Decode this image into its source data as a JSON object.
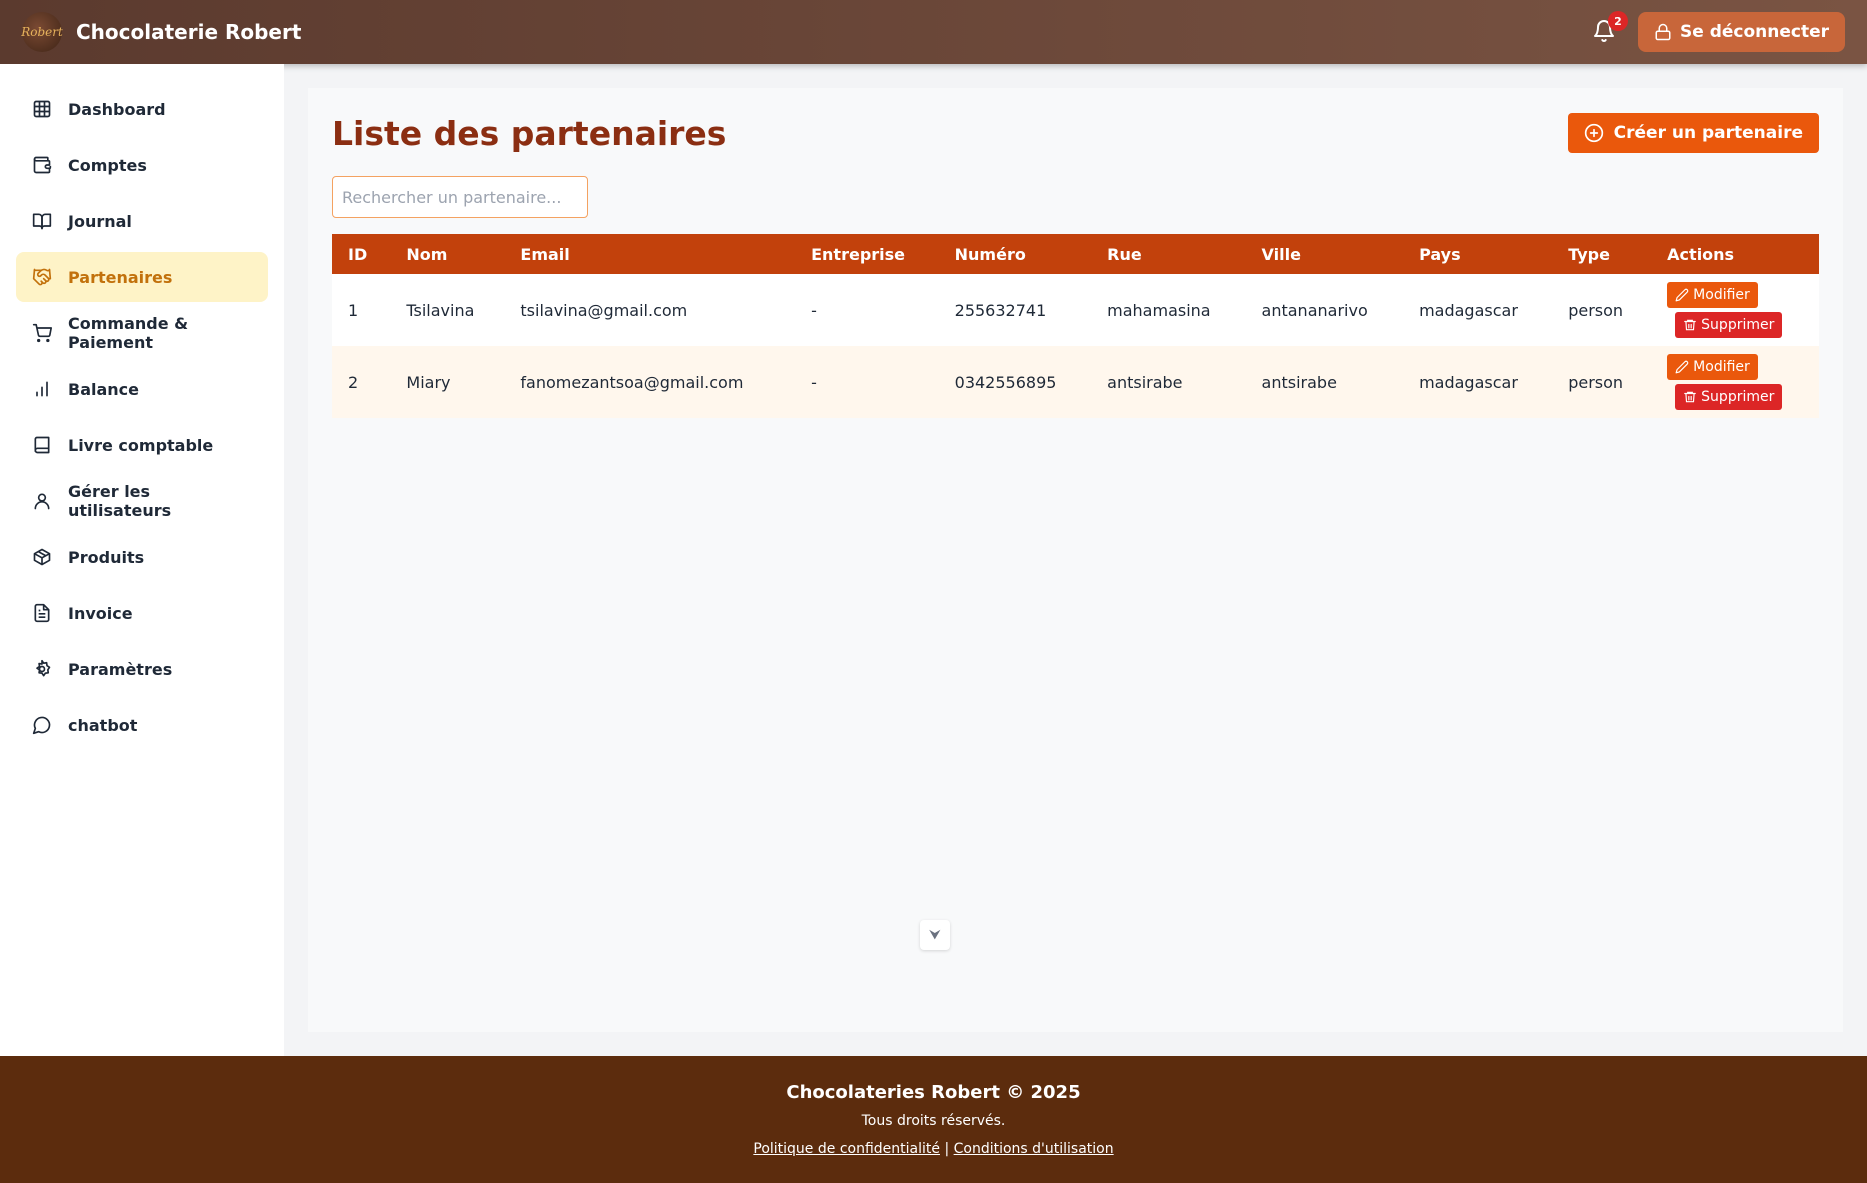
{
  "header": {
    "logo_text": "Robert",
    "brand": "Chocolaterie Robert",
    "notification_count": "2",
    "logout_label": "Se déconnecter"
  },
  "sidebar": {
    "items": [
      {
        "label": "Dashboard",
        "icon": "grid-icon"
      },
      {
        "label": "Comptes",
        "icon": "wallet-icon"
      },
      {
        "label": "Journal",
        "icon": "book-open-icon"
      },
      {
        "label": "Partenaires",
        "icon": "handshake-icon",
        "active": true
      },
      {
        "label": "Commande & Paiement",
        "icon": "cart-icon"
      },
      {
        "label": "Balance",
        "icon": "bar-chart-icon"
      },
      {
        "label": "Livre comptable",
        "icon": "book-icon"
      },
      {
        "label": "Gérer les utilisateurs",
        "icon": "user-icon"
      },
      {
        "label": "Produits",
        "icon": "package-icon"
      },
      {
        "label": "Invoice",
        "icon": "file-text-icon"
      },
      {
        "label": "Paramètres",
        "icon": "settings-icon"
      },
      {
        "label": "chatbot",
        "icon": "message-circle-icon"
      }
    ]
  },
  "main": {
    "title": "Liste des partenaires",
    "create_label": "Créer un partenaire",
    "search_placeholder": "Rechercher un partenaire...",
    "search_value": "",
    "table": {
      "headers": [
        "ID",
        "Nom",
        "Email",
        "Entreprise",
        "Numéro",
        "Rue",
        "Ville",
        "Pays",
        "Type",
        "Actions"
      ],
      "rows": [
        {
          "id": "1",
          "nom": "Tsilavina",
          "email": "tsilavina@gmail.com",
          "entreprise": "-",
          "numero": "255632741",
          "rue": "mahamasina",
          "ville": "antananarivo",
          "pays": "madagascar",
          "type": "person"
        },
        {
          "id": "2",
          "nom": "Miary",
          "email": "fanomezantsoa@gmail.com",
          "entreprise": "-",
          "numero": "0342556895",
          "rue": "antsirabe",
          "ville": "antsirabe",
          "pays": "madagascar",
          "type": "person"
        }
      ],
      "edit_label": "Modifier",
      "delete_label": "Supprimer"
    }
  },
  "footer": {
    "title": "Chocolateries Robert © 2025",
    "rights": "Tous droits réservés.",
    "privacy": "Politique de confidentialité",
    "separator": "|",
    "terms": "Conditions d'utilisation"
  },
  "colors": {
    "header": "#5b3a2e",
    "accent": "#ea580c",
    "table_header": "#c2410c",
    "delete": "#dc2626",
    "active_nav_bg": "#fef3c7",
    "footer": "#5c2c0d"
  }
}
